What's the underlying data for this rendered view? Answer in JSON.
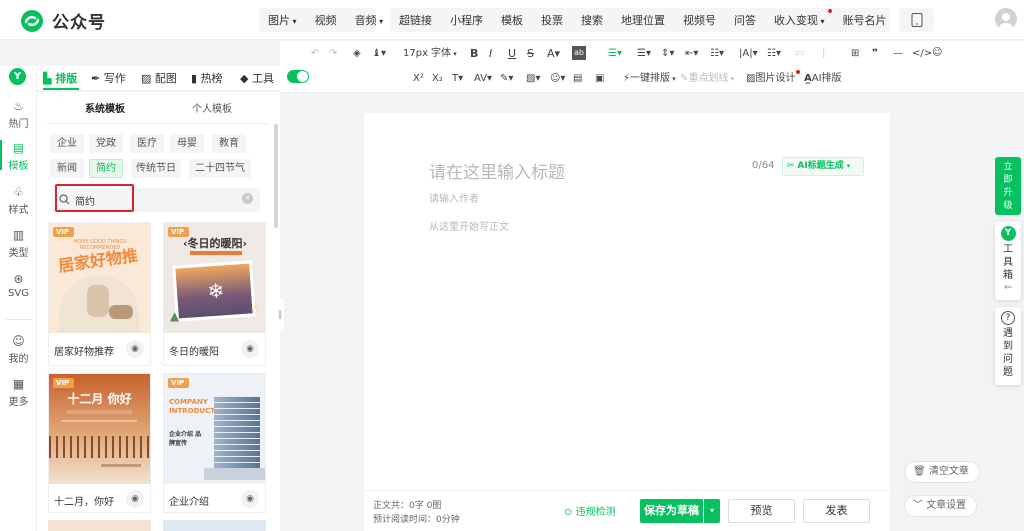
{
  "header": {
    "brand": "公众号",
    "media_group": [
      "图片",
      "视频",
      "音频"
    ],
    "insert_group": [
      "超链接",
      "小程序",
      "模板",
      "投票",
      "搜索",
      "地理位置",
      "视频号",
      "问答",
      "收入变现",
      "账号名片",
      "···"
    ]
  },
  "format_toolbar": {
    "font_size": "17px",
    "font_family": "字体",
    "one_click_layout": "一键排版",
    "highlight": "重点划线",
    "image_design": "图片设计",
    "ai_layout": "AI排版",
    "superscript": "X²",
    "subscript": "X₂"
  },
  "left_tabs": [
    "排版",
    "写作",
    "配图",
    "热榜",
    "工具"
  ],
  "rail": [
    "热门",
    "模板",
    "样式",
    "类型",
    "SVG",
    "我的",
    "更多"
  ],
  "panel": {
    "subtabs": [
      "系统模板",
      "个人模板"
    ],
    "chips_row1": [
      "企业",
      "党政",
      "医疗",
      "母婴",
      "教育"
    ],
    "chips_row2": [
      "新闻",
      "简约",
      "传统节日",
      "二十四节气"
    ],
    "active_chip": "简约",
    "search_value": "简约",
    "cards": [
      {
        "title": "居家好物推荐",
        "badge": "VIP",
        "headline": "居家好物推荐",
        "sub": "HOME GOOD THINGS RECOMMENDED"
      },
      {
        "title": "冬日的暖阳",
        "badge": "VIP",
        "headline": "冬日的暖阳"
      },
      {
        "title": "十二月，你好",
        "badge": "VIP",
        "headline": "十二月 你好"
      },
      {
        "title": "企业介绍",
        "badge": "VIP",
        "headline": "COMPANY INTRODUCTION",
        "sub": "企业介绍 品牌宣传"
      }
    ]
  },
  "editor": {
    "title_placeholder": "请在这里输入标题",
    "counter": "0/64",
    "ai_title": "AI标题生成",
    "author_placeholder": "请输入作者",
    "body_placeholder": "从这里开始写正文"
  },
  "footer": {
    "stats_line1": "正文共：0字 0图",
    "stats_line2": "预计阅读时间：0分钟",
    "check": "违规检测",
    "save_draft": "保存为草稿",
    "preview": "预览",
    "publish": "发表"
  },
  "right_rail": {
    "upgrade": "立即升级",
    "toolbox": "工具箱",
    "problem": "遇到问题",
    "clear": "清空文章",
    "settings": "文章设置"
  },
  "colors": {
    "accent": "#07c160",
    "highlight_box": "#e0222a"
  }
}
